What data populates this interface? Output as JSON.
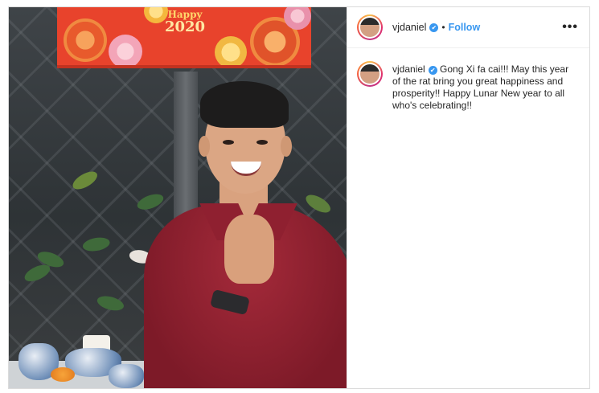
{
  "post": {
    "username": "vjdaniel",
    "follow_label": "Follow",
    "separator": "•",
    "more_label": "•••",
    "verified_icon": "✔",
    "caption": " Gong Xi fa cai!!! May this year of the rat bring you great happiness and prosperity!! Happy Lunar New year to all who's celebrating!!"
  },
  "photo": {
    "banner_top": "Happy",
    "banner_year": "2020"
  },
  "colors": {
    "link": "#3897f0",
    "text": "#262626",
    "banner": "#e8432c",
    "shirt": "#8f2030"
  }
}
